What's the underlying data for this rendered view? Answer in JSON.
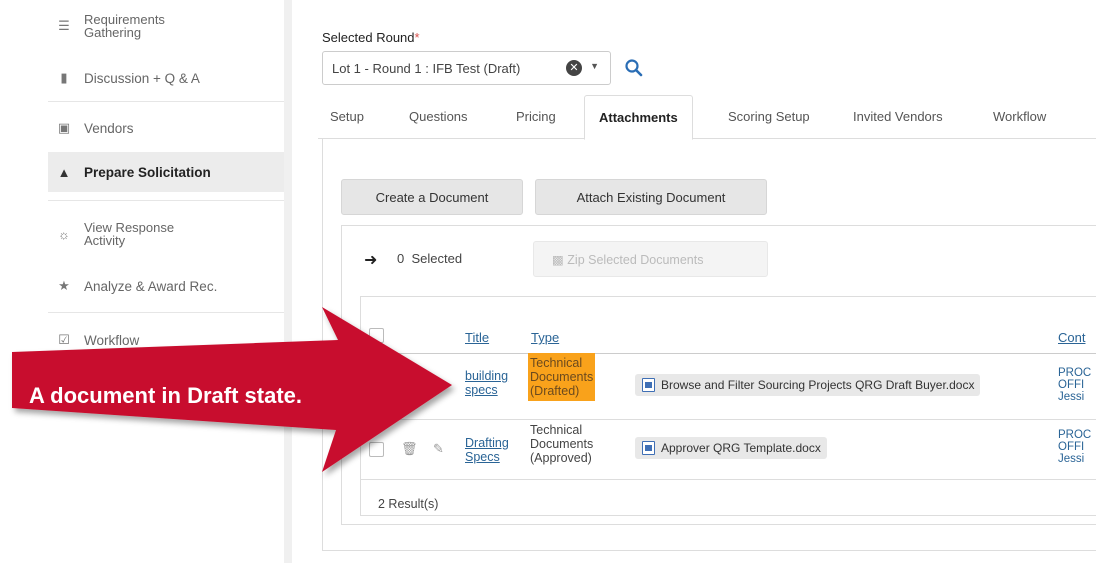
{
  "sidebar": {
    "items": [
      {
        "label_line1": "Requirements",
        "label_line2": "Gathering",
        "icon": "list-icon"
      },
      {
        "label": "Discussion + Q & A",
        "icon": "comments-icon"
      },
      {
        "label": "Vendors",
        "icon": "truck-icon"
      },
      {
        "label": "Prepare Solicitation",
        "icon": "folder-open-icon",
        "active": true
      },
      {
        "label_line1": "View Response",
        "label_line2": "Activity",
        "icon": "binoculars-icon"
      },
      {
        "label": "Analyze & Award Rec.",
        "icon": "trophy-icon"
      },
      {
        "label": "Workflow",
        "icon": "checkbox-icon"
      }
    ]
  },
  "round": {
    "label": "Selected Round",
    "required_mark": "*",
    "value": "Lot 1 - Round 1 : IFB Test (Draft)"
  },
  "tabs": [
    "Setup",
    "Questions",
    "Pricing",
    "Attachments",
    "Scoring Setup",
    "Invited Vendors",
    "Workflow"
  ],
  "active_tab": "Attachments",
  "buttons": {
    "create": "Create a Document",
    "attach": "Attach Existing Document",
    "zip": "Zip Selected Documents"
  },
  "selection": {
    "count": "0",
    "label": "Selected"
  },
  "table": {
    "headers": {
      "title": "Title",
      "type": "Type",
      "contact": "Cont"
    },
    "rows": [
      {
        "title_line1": "building",
        "title_line2": "specs",
        "type_line1": "Technical",
        "type_line2": "Documents",
        "type_line3": "(Drafted)",
        "file": "Browse and Filter Sourcing Projects QRG Draft Buyer.docx",
        "contact_line1": "PROC",
        "contact_line2": "OFFI",
        "contact_line3": "Jessi"
      },
      {
        "title_line1": "Drafting",
        "title_line2": "Specs",
        "type_line1": "Technical",
        "type_line2": "Documents",
        "type_line3": "(Approved)",
        "file": "Approver QRG Template.docx",
        "contact_line1": "PROC",
        "contact_line2": "OFFI",
        "contact_line3": "Jessi"
      }
    ],
    "results": "2 Result(s)"
  },
  "callout": {
    "text": "A document in Draft state.",
    "color": "#c8102e"
  },
  "colors": {
    "draft_highlight": "#f9a21b",
    "link": "#2a6496",
    "active_bg": "#ececec"
  }
}
